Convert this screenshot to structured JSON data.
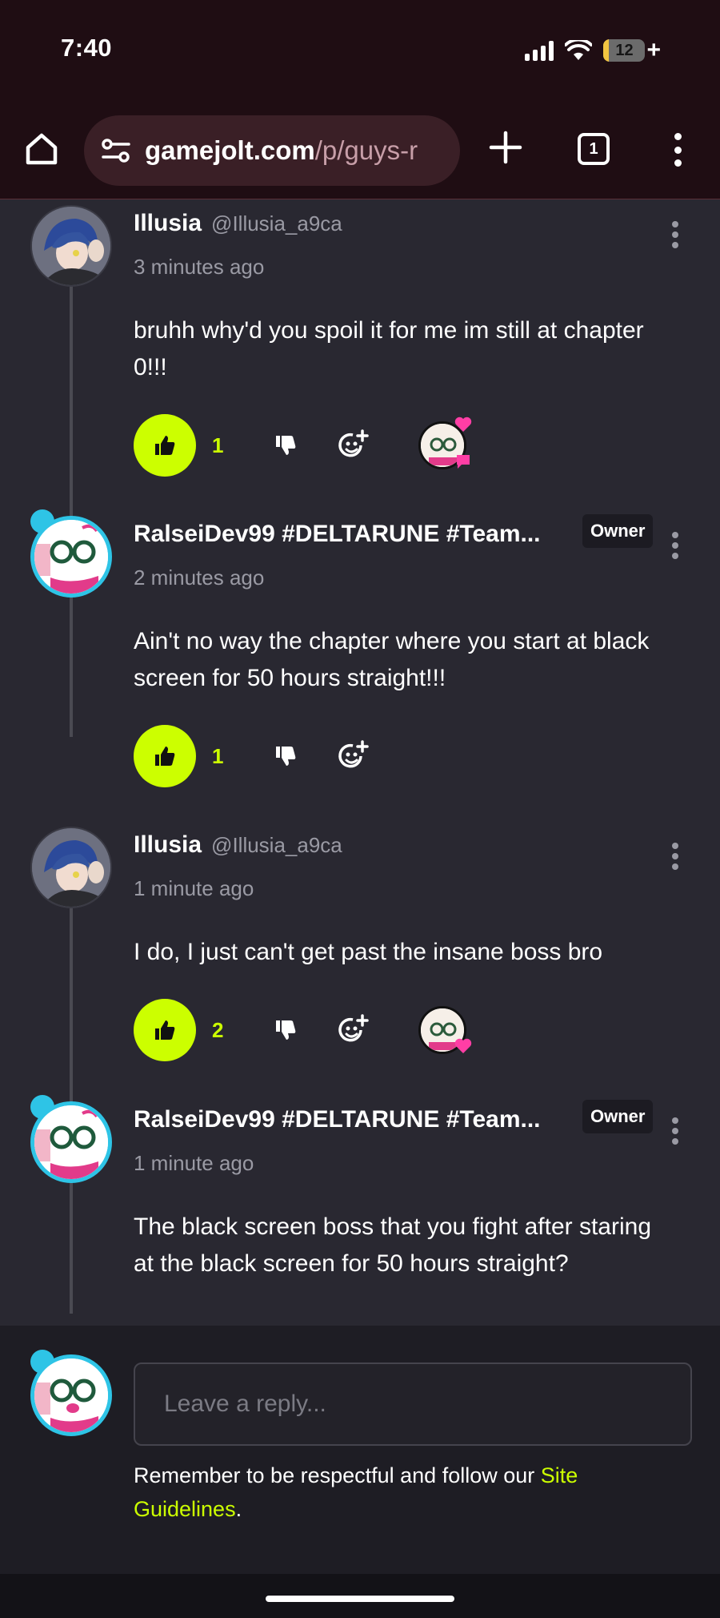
{
  "status_bar": {
    "time": "7:40",
    "battery": "12"
  },
  "browser": {
    "url_domain": "gamejolt.com",
    "url_path": "/p/guys-r",
    "tab_count": "1"
  },
  "comments": [
    {
      "name": "Illusia",
      "handle": "@Illusia_a9ca",
      "time": "3 minutes ago",
      "text": "bruhh why'd you spoil it for me im still at chapter 0!!!",
      "likes": "1"
    },
    {
      "name": "RalseiDev99 #DELTARUNE #Team...",
      "badge": "Owner",
      "time": "2 minutes ago",
      "text": "Ain't no way the chapter where you start at black screen for 50 hours straight!!!",
      "likes": "1"
    },
    {
      "name": "Illusia",
      "handle": "@Illusia_a9ca",
      "time": "1 minute ago",
      "text": "I do, I just can't get past the insane boss bro",
      "likes": "2"
    },
    {
      "name": "RalseiDev99 #DELTARUNE #Team...",
      "badge": "Owner",
      "time": "1 minute ago",
      "text": "The black screen boss that you fight after staring at the black screen for 50 hours straight?"
    }
  ],
  "composer": {
    "placeholder": "Leave a reply...",
    "reminder_text": "Remember to be respectful and follow our ",
    "link_text": "Site Guidelines",
    "reminder_end": "."
  },
  "colors": {
    "accent": "#ccff00",
    "background": "#292831",
    "chrome": "#1f0d13",
    "ring": "#2ec4e6",
    "heart": "#ff3ea5"
  }
}
